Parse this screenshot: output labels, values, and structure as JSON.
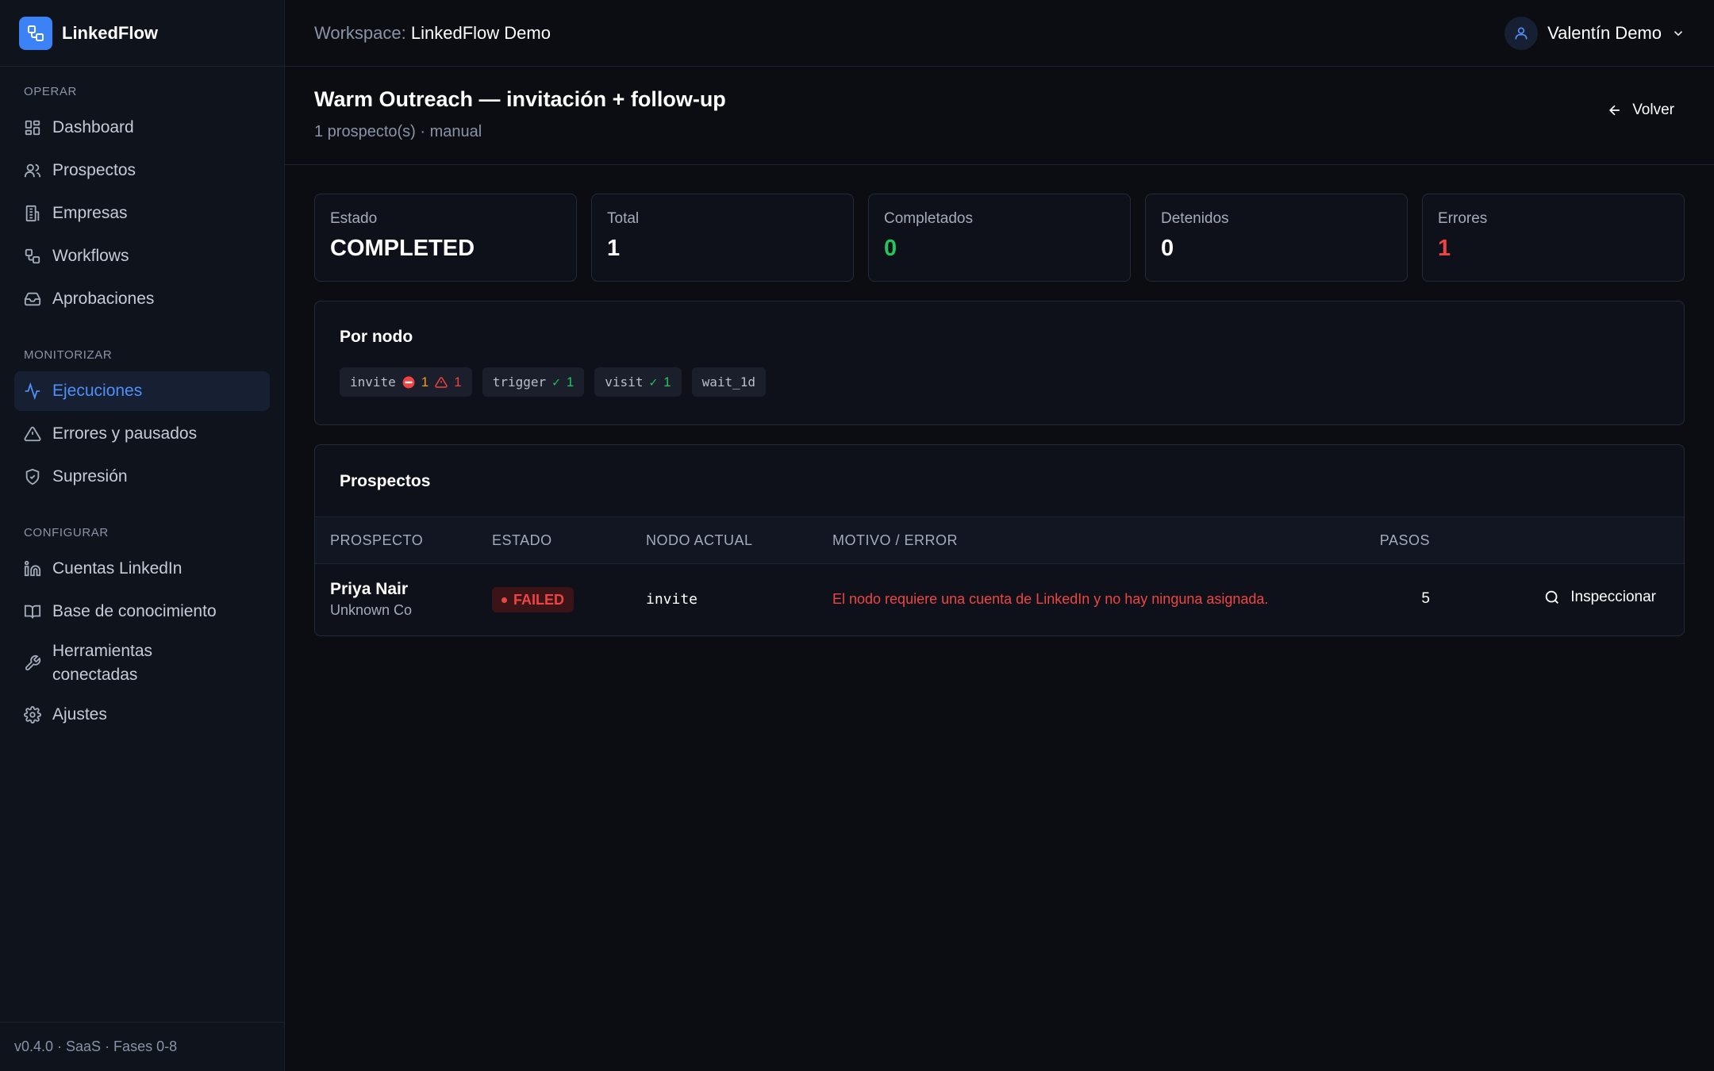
{
  "brand": {
    "name": "LinkedFlow"
  },
  "sidebar": {
    "sections": [
      {
        "heading": "OPERAR",
        "items": [
          {
            "label": "Dashboard",
            "icon": "dashboard-icon"
          },
          {
            "label": "Prospectos",
            "icon": "users-icon"
          },
          {
            "label": "Empresas",
            "icon": "building-icon"
          },
          {
            "label": "Workflows",
            "icon": "workflow-icon"
          },
          {
            "label": "Aprobaciones",
            "icon": "inbox-icon"
          }
        ]
      },
      {
        "heading": "MONITORIZAR",
        "items": [
          {
            "label": "Ejecuciones",
            "icon": "activity-icon",
            "active": true
          },
          {
            "label": "Errores y pausados",
            "icon": "alert-triangle-icon"
          },
          {
            "label": "Supresión",
            "icon": "shield-icon"
          }
        ]
      },
      {
        "heading": "CONFIGURAR",
        "items": [
          {
            "label": "Cuentas LinkedIn",
            "icon": "linkedin-icon"
          },
          {
            "label": "Base de conocimiento",
            "icon": "book-icon"
          },
          {
            "label": "Herramientas conectadas",
            "icon": "wrench-icon"
          },
          {
            "label": "Ajustes",
            "icon": "gear-icon"
          }
        ]
      }
    ],
    "footer": "v0.4.0 · SaaS · Fases 0-8"
  },
  "topbar": {
    "workspace_label": "Workspace:",
    "workspace_name": "LinkedFlow Demo",
    "user_name": "Valentín Demo"
  },
  "page": {
    "title": "Warm Outreach — invitación + follow-up",
    "subtitle": "1 prospecto(s) · manual",
    "back_label": "Volver"
  },
  "stats": [
    {
      "label": "Estado",
      "value": "COMPLETED",
      "tone": "default"
    },
    {
      "label": "Total",
      "value": "1",
      "tone": "default"
    },
    {
      "label": "Completados",
      "value": "0",
      "tone": "green"
    },
    {
      "label": "Detenidos",
      "value": "0",
      "tone": "default"
    },
    {
      "label": "Errores",
      "value": "1",
      "tone": "red"
    }
  ],
  "nodes_panel": {
    "title": "Por nodo",
    "chips": [
      {
        "name": "invite",
        "stopped": "1",
        "errors": "1"
      },
      {
        "name": "trigger",
        "completed": "1"
      },
      {
        "name": "visit",
        "completed": "1"
      },
      {
        "name": "wait_1d"
      }
    ]
  },
  "prospects_panel": {
    "title": "Prospectos",
    "columns": [
      "PROSPECTO",
      "ESTADO",
      "NODO ACTUAL",
      "MOTIVO / ERROR",
      "PASOS"
    ],
    "rows": [
      {
        "name": "Priya Nair",
        "company": "Unknown Co",
        "status": "FAILED",
        "node": "invite",
        "reason": "El nodo requiere una cuenta de LinkedIn y no hay ninguna asignada.",
        "steps": "5",
        "action": "Inspeccionar"
      }
    ]
  },
  "colors": {
    "accent": "#3b82f6",
    "success": "#22c55e",
    "danger": "#ef4444",
    "warning": "#f59e0b"
  }
}
